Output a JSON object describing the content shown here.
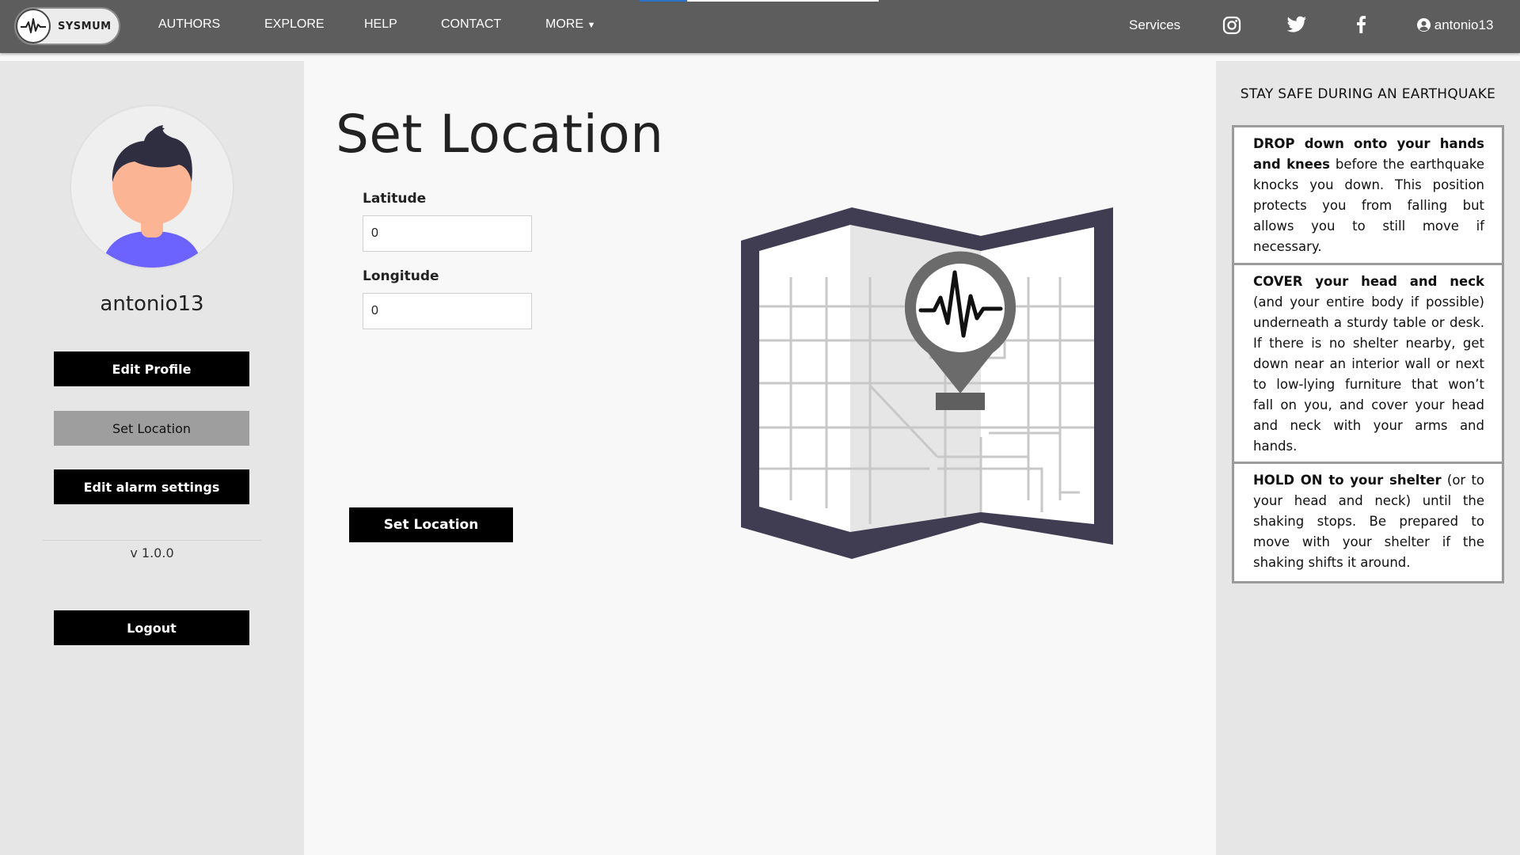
{
  "nav": {
    "logo_text": "SYSMUM",
    "links": [
      "AUTHORS",
      "EXPLORE",
      "HELP",
      "CONTACT",
      "MORE"
    ],
    "services": "Services",
    "user": "antonio13",
    "social_icons": [
      "instagram-icon",
      "twitter-icon",
      "facebook-icon"
    ]
  },
  "sidebar": {
    "username": "antonio13",
    "buttons": {
      "edit_profile": "Edit Profile",
      "set_location": "Set Location",
      "edit_alarm": "Edit alarm settings",
      "logout": "Logout"
    },
    "version": "v 1.0.0"
  },
  "main": {
    "title": "Set Location",
    "latitude_label": "Latitude",
    "latitude_value": "0",
    "longitude_label": "Longitude",
    "longitude_value": "0",
    "submit_label": "Set Location"
  },
  "tips": {
    "title": "STAY SAFE DURING AN EARTHQUAKE",
    "cards": [
      {
        "bold": "DROP down onto your hands and knees",
        "text": " before the earthquake knocks you down. This position protects you from falling but allows you to still move if necessary."
      },
      {
        "bold": "COVER your head and neck",
        "text": " (and your entire body if possible) underneath a sturdy table or desk. If there is no shelter nearby, get down near an interior wall or next to low-lying furniture that won’t fall on you, and cover your head and neck with your arms and hands."
      },
      {
        "bold": "HOLD ON to your shelter",
        "text": " (or to your head and neck) until the shaking stops. Be prepared to move with your shelter if the shaking shifts it around."
      }
    ]
  },
  "colors": {
    "nav_bg": "#5d5d5d",
    "sidebar_bg": "#e6e6e6",
    "button_bg": "#000000",
    "active_button_bg": "#9e9e9e",
    "map_frame": "#403c52"
  }
}
